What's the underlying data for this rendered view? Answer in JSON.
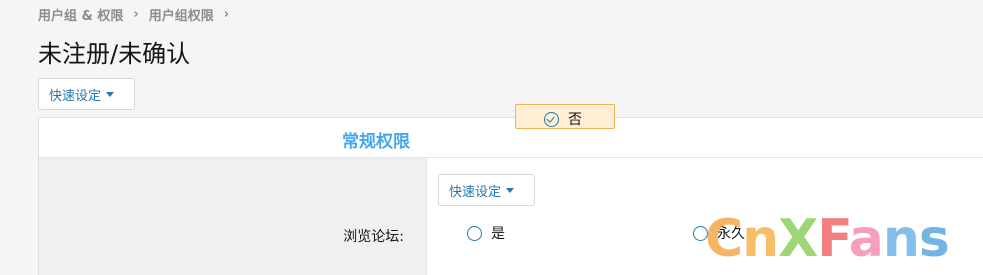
{
  "breadcrumb": {
    "items": [
      "用户组 & 权限",
      "用户组权限"
    ],
    "separator": "›"
  },
  "page": {
    "title": "未注册/未确认"
  },
  "quick_set": {
    "label": "快速设定"
  },
  "panel": {
    "section_title": "常规权限",
    "row": {
      "label": "浏览论坛:",
      "quick_set_label": "快速设定",
      "options": [
        {
          "label": "是",
          "selected": false
        },
        {
          "label": "否",
          "selected": true
        },
        {
          "label": "永久",
          "selected": false
        }
      ]
    }
  },
  "watermark": {
    "letters": [
      "C",
      "n",
      "X",
      "F",
      "a",
      "n",
      "s"
    ],
    "colors": [
      "#f5a94a",
      "#f7b24e",
      "#8ccf5c",
      "#f06a6a",
      "#f48fb1",
      "#6fb3e8",
      "#5aa8e0"
    ]
  },
  "colors": {
    "accent": "#2577b1",
    "section_title": "#47a7eb",
    "selected_bg": "#fdeed4",
    "selected_border": "#f0b358"
  }
}
